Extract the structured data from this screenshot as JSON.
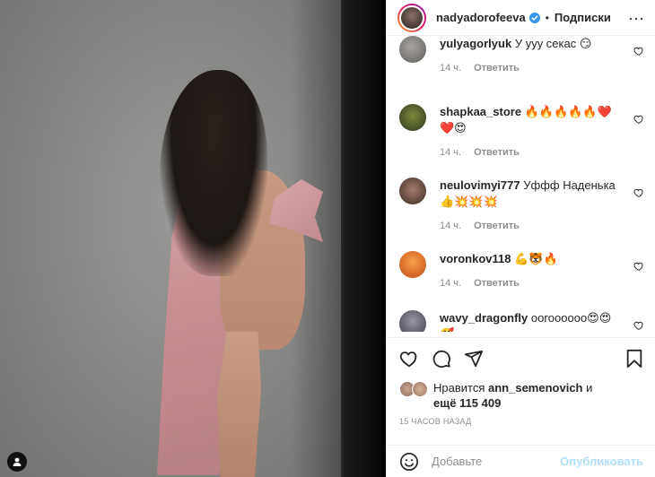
{
  "header": {
    "username": "nadyadorofeeva",
    "separator": "•",
    "follow_label": "Подписки",
    "more_label": "···"
  },
  "comments": [
    {
      "username": "yulyagorlyuk",
      "text": "У ууу секас 😏",
      "time": "14 ч.",
      "reply": "Ответить",
      "avatar_color": "#6b6a66"
    },
    {
      "username": "shapkaa_store",
      "text": "🔥🔥🔥🔥🔥❤️❤️😍",
      "time": "14 ч.",
      "reply": "Ответить",
      "avatar_color": "#3f4a2e"
    },
    {
      "username": "neulovimyi777",
      "text": "Уффф Наденька 👍💥💥💥",
      "time": "14 ч.",
      "reply": "Ответить",
      "avatar_color": "#5a463e"
    },
    {
      "username": "voronkov118",
      "text": "💪🐯🔥",
      "time": "14 ч.",
      "reply": "Ответить",
      "avatar_color": "#d9772a"
    },
    {
      "username": "wavy_dragonfly",
      "text": "оогоооооо😍😍🥰",
      "time": "",
      "reply": "",
      "avatar_color": "#5d5a66"
    }
  ],
  "likes": {
    "prefix": "Нравится",
    "liker": "ann_semenovich",
    "conjunction": "и",
    "more_prefix": "ещё",
    "count": "115 409"
  },
  "timestamp": "15 ЧАСОВ НАЗАД",
  "add_comment": {
    "placeholder": "Добавьте",
    "publish_label": "Опубликовать"
  },
  "colors": {
    "verified": "#3897f0",
    "publish_disabled": "#b2dffc",
    "muted": "#8e8e8e"
  }
}
